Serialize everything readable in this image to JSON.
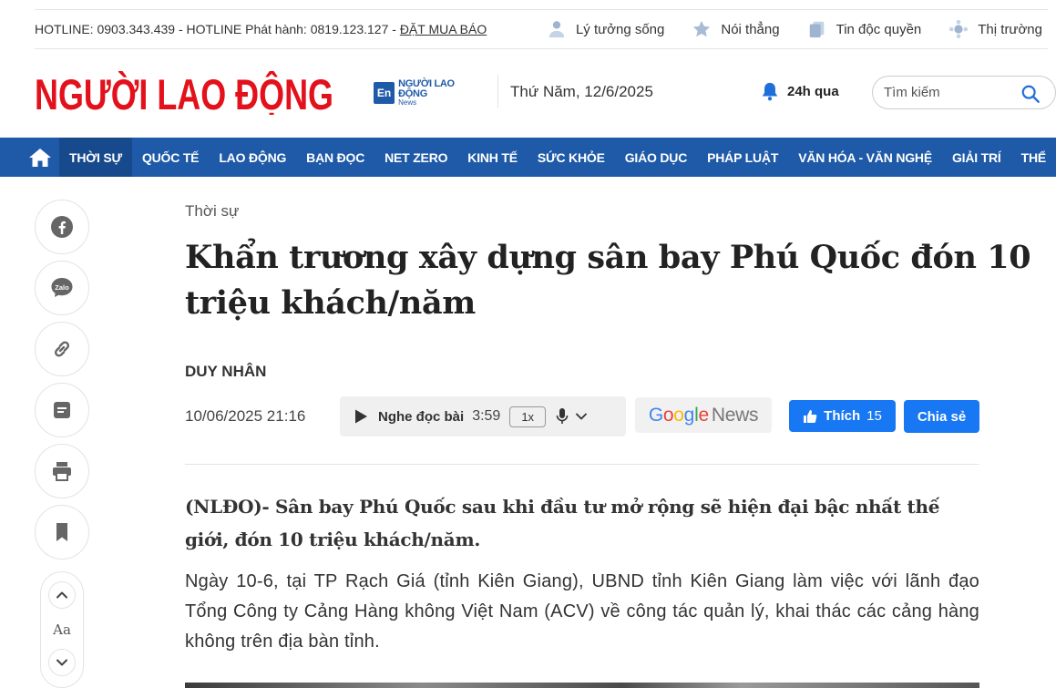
{
  "topbar": {
    "hotline_text": "HOTLINE: 0903.343.439 - HOTLINE Phát hành: 0819.123.127 - ",
    "buy_link": "ĐẶT MUA BÁO",
    "links": [
      {
        "label": "Lý tưởng sống",
        "icon": "person-icon"
      },
      {
        "label": "Nói thẳng",
        "icon": "star-icon"
      },
      {
        "label": "Tin độc quyền",
        "icon": "documents-icon"
      },
      {
        "label": "Thị trường",
        "icon": "market-icon"
      }
    ]
  },
  "header": {
    "logo_text": "NGƯỜI LAO ĐỘNG",
    "en_badge": "En",
    "en_logo_line1": "NGƯỜI LAO ĐỘNG",
    "en_logo_line2": "News",
    "date": "Thứ Năm, 12/6/2025",
    "h24_label": "24h qua",
    "search_placeholder": "Tìm kiếm",
    "brand_red": "#e3111b",
    "brand_blue": "#1e5aa8"
  },
  "nav": {
    "items": [
      "THỜI SỰ",
      "QUỐC TẾ",
      "LAO ĐỘNG",
      "BẠN ĐỌC",
      "NET ZERO",
      "KINH TẾ",
      "SỨC KHỎE",
      "GIÁO DỤC",
      "PHÁP LUẬT",
      "VĂN HÓA - VĂN NGHỆ",
      "GIẢI TRÍ",
      "THỂ"
    ]
  },
  "rail": {
    "buttons": [
      "facebook-icon",
      "zalo-icon",
      "link-icon",
      "comment-icon",
      "print-icon",
      "bookmark-icon"
    ],
    "font_label": "Aa",
    "zalo_text": "Zalo"
  },
  "article": {
    "category": "Thời sự",
    "title": "Khẩn trương xây dựng sân bay Phú Quốc đón 10 triệu khách/năm",
    "author": "DUY NHÂN",
    "published": "10/06/2025 21:16",
    "audio": {
      "label": "Nghe đọc bài",
      "duration": "3:59",
      "speed": "1x"
    },
    "google_news": {
      "google": "Google",
      "news": "News"
    },
    "like": {
      "label": "Thích",
      "count": "15"
    },
    "share_label": "Chia sẻ",
    "lead": "(NLĐO)- Sân bay Phú Quốc sau khi đầu tư mở rộng sẽ hiện đại bậc nhất thế giới, đón 10 triệu khách/năm.",
    "paragraph": "Ngày 10-6, tại TP Rạch Giá (tỉnh Kiên Giang), UBND tỉnh Kiên Giang làm việc với lãnh đạo Tổng Công ty Cảng Hàng không Việt Nam (ACV) về công tác quản lý, khai thác các cảng hàng không trên địa bàn tỉnh."
  }
}
